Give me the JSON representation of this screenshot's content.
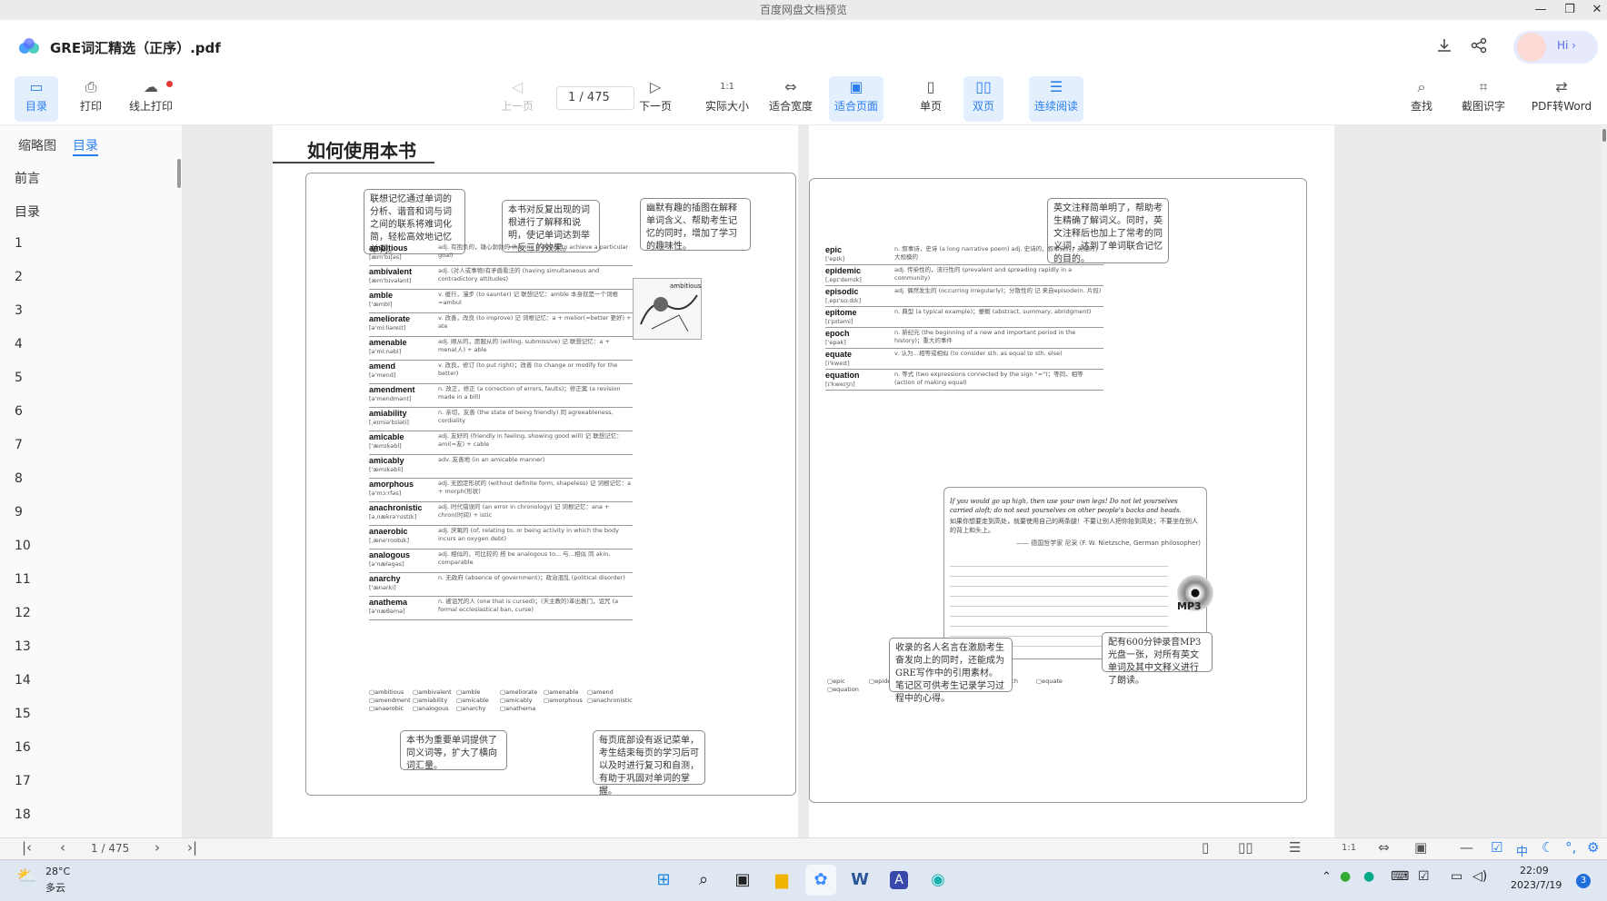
{
  "window": {
    "title": "百度网盘文档预览",
    "minimize": "—",
    "maximize": "❐",
    "close": "✕"
  },
  "app": {
    "filename": "GRE词汇精选（正序）.pdf",
    "hi": "Hi ›"
  },
  "toolbar": {
    "toc": "目录",
    "print": "打印",
    "online_print": "线上打印",
    "prev": "上一页",
    "page_current": "1",
    "page_total": "/ 475",
    "next": "下一页",
    "actual_size": "实际大小",
    "fit_width": "适合宽度",
    "fit_page": "适合页面",
    "single": "单页",
    "double": "双页",
    "continuous": "连续阅读",
    "search": "查找",
    "ocr": "截图识字",
    "pdf2word": "PDF转Word",
    "actual_icon": "1:1"
  },
  "sidebar": {
    "tab_thumb": "缩略图",
    "tab_toc": "目录",
    "items": [
      "前言",
      "目录",
      "1",
      "2",
      "3",
      "4",
      "5",
      "6",
      "7",
      "8",
      "9",
      "10",
      "11",
      "12",
      "13",
      "14",
      "15",
      "16",
      "17",
      "18"
    ]
  },
  "left_page": {
    "heading": "如何使用本书",
    "callout1": "联想记忆通过单词的分析、谐音和词与词之间的联系将难词化简，轻松高效地记忆单词。",
    "callout2": "本书对反复出现的词根进行了解释和说明，使记单词达到举一反三的效果。",
    "callout3": "幽默有趣的插图在解释单词含义、帮助考生记忆的同时，增加了学习的趣味性。",
    "callout4": "本书为重要单词提供了同义词等，扩大了横向词汇量。",
    "callout5": "每页底部设有返记菜单，考生结束每页的学习后可以及时进行复习和自测，有助于巩固对单词的掌握。",
    "image_label": "ambitious",
    "entries": [
      {
        "w": "ambitious",
        "p": "[æm'bɪʃəs]",
        "d": "adj. 有抱负的，雄心勃勃的 (having a desire to achieve a particular goal)"
      },
      {
        "w": "ambivalent",
        "p": "[æm'bɪvələnt]",
        "d": "adj. (对人或事物)有矛盾看法的 (having simultaneous and contradictory attitudes)"
      },
      {
        "w": "amble",
        "p": "['æmbl]",
        "d": "v. 缓行，漫步 (to saunter)  记 联想记忆：amble 本身就是一个词根=ambul"
      },
      {
        "w": "ameliorate",
        "p": "[ə'miːliəreɪt]",
        "d": "v. 改善，改良 (to improve)  记 词根记忆：a + melior(=better 更好) + ate"
      },
      {
        "w": "amenable",
        "p": "[ə'miːnəbl]",
        "d": "adj. 顺从的，愿服从的 (willing, submissive)  记 联想记忆：a + mena(人) + able"
      },
      {
        "w": "amend",
        "p": "[ə'mend]",
        "d": "v. 改良，修订 (to put right)；改善 (to change or modify for the better)"
      },
      {
        "w": "amendment",
        "p": "[ə'mendmənt]",
        "d": "n. 改正，修正 (a correction of errors, faults)；修正案 (a revision made in a bill)"
      },
      {
        "w": "amiability",
        "p": "[ˌeɪmiə'bɪləti]",
        "d": "n. 亲切，友善 (the state of being friendly)  同 agreeableness, cordiality"
      },
      {
        "w": "amicable",
        "p": "['æmɪkəbl]",
        "d": "adj. 友好的 (friendly in feeling, showing good will)  记 联想记忆：ami(=友) + cable"
      },
      {
        "w": "amicably",
        "p": "['æmɪkəbli]",
        "d": "adv. 友善地 (in an amicable manner)"
      },
      {
        "w": "amorphous",
        "p": "[ə'mɔːrfəs]",
        "d": "adj. 无固定形状的 (without definite form, shapeless)  记 词根记忆：a + morph(形状)"
      },
      {
        "w": "anachronistic",
        "p": "[əˌnækrə'nɪstɪk]",
        "d": "adj. 时代错误的 (an error in chronology)  记 词根记忆：ana + chron(时间) + istic"
      },
      {
        "w": "anaerobic",
        "p": "[ˌæne'roʊbɪk]",
        "d": "adj. 厌氧的 (of, relating to, or being activity in which the body incurs an oxygen debt)"
      },
      {
        "w": "analogous",
        "p": "[ə'næləgəs]",
        "d": "adj. 相似的，可比较的  搭 be analogous to... 与…相似  同 akin, comparable"
      },
      {
        "w": "anarchy",
        "p": "['ænərki]",
        "d": "n. 无政府 (absence of government)；政治混乱 (political disorder)"
      },
      {
        "w": "anathema",
        "p": "[ə'næθəmə]",
        "d": "n. 被诅咒的人 (one that is cursed)；(天主教的)革出教门，诅咒 (a formal ecclesiastical ban, curse)"
      }
    ],
    "checks": [
      "ambitious",
      "ambivalent",
      "amble",
      "ameliorate",
      "amenable",
      "amend",
      "amendment",
      "amiability",
      "amicable",
      "amicably",
      "amorphous",
      "anachronistic",
      "anaerobic",
      "analogous",
      "anarchy",
      "anathema"
    ]
  },
  "right_page": {
    "callout1": "英文注释简单明了，帮助考生精确了解词义。同时，英文注释后也加上了常考的同义词，达到了单词联合记忆的目的。",
    "callout2": "收录的名人名言在激励考生奋发向上的同时，还能成为GRE写作中的引用素材。笔记区可供考生记录学习过程中的心得。",
    "callout3": "配有600分钟录音MP3光盘一张，对所有英文单词及其中文释义进行了朗读。",
    "mp3": "MP3",
    "quote_en": "If you would go up high, then use your own legs!  Do not let yourselves carried aloft; do not seat yourselves on other people's backs and heads.",
    "quote_cn": "如果你想要走到高处，就要使用自己的两条腿！不要让别人把你抬到高处；不要坐在别人的背上和头上。",
    "quote_author": "—— 德国哲学家 尼采 (F. W. Nietzsche, German philosopher)",
    "entries": [
      {
        "w": "epic",
        "p": "['epɪk]",
        "d": "n. 叙事诗，史诗 (a long narrative poem) adj. 史诗的，叙事诗的；英雄的；大规模的"
      },
      {
        "w": "epidemic",
        "p": "[ˌepɪ'demɪk]",
        "d": "adj. 传染性的，流行性的 (prevalent and spreading rapidly in a community)"
      },
      {
        "w": "episodic",
        "p": "[ˌepɪ'sɑːdɪk]",
        "d": "adj. 偶然发生的 (occurring irregularly)；分散性的  记 来自episode(n. 片段)"
      },
      {
        "w": "epitome",
        "p": "[ɪ'pɪtəmi]",
        "d": "n. 典型 (a typical example)；梗概 (abstract, summary, abridgment)"
      },
      {
        "w": "epoch",
        "p": "['epək]",
        "d": "n. 新纪元 (the beginning of a new and important period in the history)；重大的事件"
      },
      {
        "w": "equate",
        "p": "[i'kweɪt]",
        "d": "v. 认为…相等或相似 (to consider sth. as equal to sth. else)"
      },
      {
        "w": "equation",
        "p": "[ɪ'kweɪʒn]",
        "d": "n. 等式 (two expressions connected by the sign \"=\")；等同，相等 (action of making equal)"
      }
    ],
    "checks": [
      "epic",
      "epidemic",
      "episodic",
      "epitome",
      "epoch",
      "equate",
      "equation"
    ]
  },
  "bottombar": {
    "page_current": "1",
    "page_total": "/ 475",
    "first": "|‹",
    "prev": "‹",
    "next": "›",
    "last": "›|",
    "actual_icon": "1:1",
    "zoom_out": "—"
  },
  "taskbar": {
    "temp": "28°C",
    "weather": "多云",
    "time": "22:09",
    "date": "2023/7/19",
    "badge": "3",
    "ime": "中"
  },
  "colors": {
    "accent": "#2a7ef0",
    "active_bg": "#e3effd",
    "dot": "#e53935"
  }
}
